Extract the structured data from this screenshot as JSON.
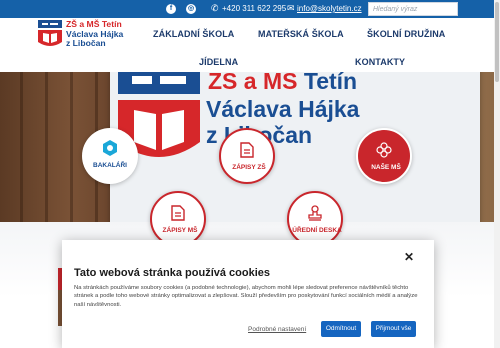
{
  "topbar": {
    "facebook_icon": "facebook-icon",
    "instagram_icon": "instagram-icon",
    "phone": "+420 311 622 295",
    "email": "info@skolytetin.cz",
    "search_placeholder": "Hledaný výraz"
  },
  "logo": {
    "line1": "ZŠ a MŠ Tetín",
    "line2": "Václava Hájka",
    "line3": "z Libočan"
  },
  "nav": {
    "items": [
      "ZÁKLADNÍ ŠKOLA",
      "MATEŘSKÁ ŠKOLA",
      "ŠKOLNÍ DRUŽINA",
      "JÍDELNA",
      "KONTAKTY"
    ]
  },
  "hero": {
    "banner_line1_red": "ZŠ a MŠ",
    "banner_line1_blue": "Tetín",
    "banner_line2": "Václava Hájka",
    "banner_line3": "z Libočan"
  },
  "quicklinks": [
    {
      "label": "BAKALÁŘI",
      "icon": "bakalari-icon"
    },
    {
      "label": "ZÁPISY ZŠ",
      "icon": "document-icon"
    },
    {
      "label": "NAŠE MŠ",
      "icon": "flower-icon"
    },
    {
      "label": "ZÁPISY MŠ",
      "icon": "document-icon"
    },
    {
      "label": "ÚŘEDNÍ DESKA",
      "icon": "stamp-icon"
    }
  ],
  "cookie": {
    "title": "Tato webová stránka používá cookies",
    "body": "Na stránkách používáme soubory cookies (a podobné technologie), abychom mohli lépe sledovat preference návštěvníků těchto stránek a podle toho webové stránky optimalizovat a zlepšovat. Slouží především pro poskytování funkcí sociálních médií a analýze naší návštěvnosti.",
    "settings_link": "Podrobné nastavení",
    "reject": "Odmítnout",
    "accept": "Přijmout vše"
  },
  "colors": {
    "brand_blue": "#1561a8",
    "brand_red": "#c9262c",
    "nav_text": "#1c3a6b",
    "button_blue": "#1565c0"
  }
}
